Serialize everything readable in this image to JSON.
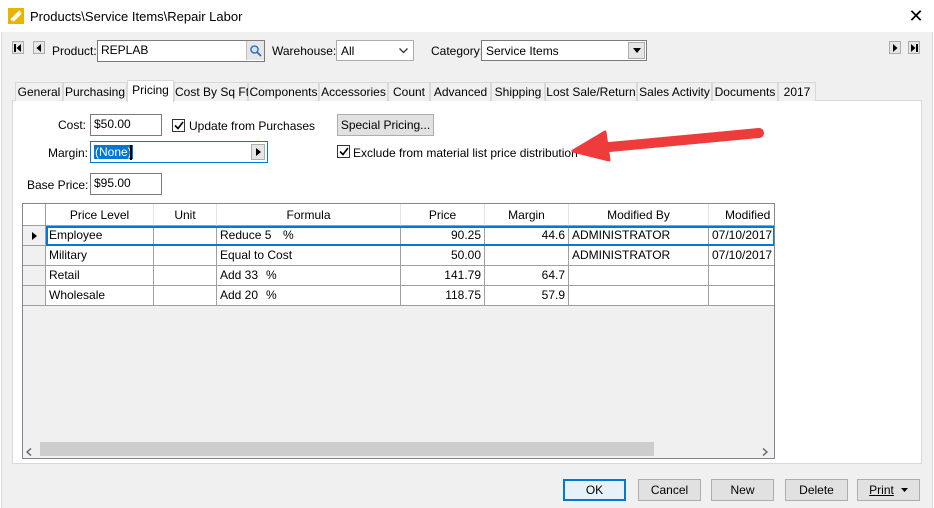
{
  "window": {
    "title": "Products\\Service Items\\Repair Labor",
    "close_glyph": "✕"
  },
  "header": {
    "product_label": "Product:",
    "product_value": "REPLAB",
    "warehouse_label": "Warehouse:",
    "warehouse_value": "All",
    "category_label": "Category:",
    "category_value": "Service Items"
  },
  "tabs": [
    "General",
    "Purchasing",
    "Pricing",
    "Cost By Sq Ft",
    "Components",
    "Accessories",
    "Count",
    "Advanced",
    "Shipping",
    "Lost Sale/Return",
    "Sales Activity",
    "Documents",
    "2017"
  ],
  "active_tab": "Pricing",
  "pricing": {
    "cost_label": "Cost:",
    "cost_value": "$50.00",
    "update_label": "Update from Purchases",
    "update_checked": true,
    "special_pricing_label": "Special Pricing...",
    "margin_label": "Margin:",
    "margin_value": "(None)",
    "exclude_label": "Exclude from material list price distribution",
    "exclude_checked": true,
    "base_price_label": "Base Price:",
    "base_price_value": "$95.00"
  },
  "grid": {
    "columns": [
      "Price Level",
      "Unit",
      "Formula",
      "Price",
      "Margin",
      "Modified By",
      "Modified D"
    ],
    "rows": [
      {
        "price_level": "Employee",
        "unit": "",
        "formula": "Reduce 5",
        "formula_unit": "%",
        "price": "90.25",
        "margin": "44.6",
        "modified_by": "ADMINISTRATOR",
        "modified_date": "07/10/2017",
        "current": true
      },
      {
        "price_level": "Military",
        "unit": "",
        "formula": "Equal to Cost",
        "formula_unit": "",
        "price": "50.00",
        "margin": "",
        "modified_by": "ADMINISTRATOR",
        "modified_date": "07/10/2017",
        "current": false
      },
      {
        "price_level": "Retail",
        "unit": "",
        "formula": "Add 33",
        "formula_unit": "%",
        "price": "141.79",
        "margin": "64.7",
        "modified_by": "",
        "modified_date": "",
        "current": false
      },
      {
        "price_level": "Wholesale",
        "unit": "",
        "formula": "Add 20",
        "formula_unit": "%",
        "price": "118.75",
        "margin": "57.9",
        "modified_by": "",
        "modified_date": "",
        "current": false
      }
    ]
  },
  "footer": {
    "ok": "OK",
    "cancel": "Cancel",
    "new": "New",
    "delete": "Delete",
    "print": "Print"
  },
  "colors": {
    "annotation_arrow": "#ee3b3b",
    "selection": "#0078d7",
    "dialog_bg": "#f0f0f0"
  }
}
